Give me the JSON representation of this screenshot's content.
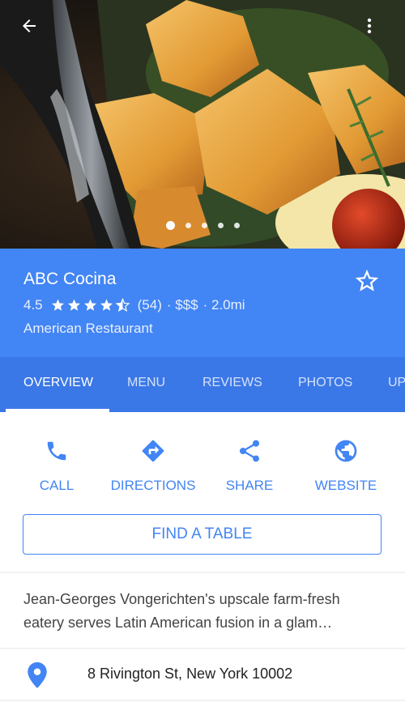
{
  "place": {
    "name": "ABC Cocina",
    "rating": "4.5",
    "review_count": "(54)",
    "price": "· $$$",
    "distance": "· 2.0mi",
    "category": "American Restaurant"
  },
  "tabs": [
    "OVERVIEW",
    "MENU",
    "REVIEWS",
    "PHOTOS",
    "UP"
  ],
  "actions": {
    "call": "CALL",
    "directions": "DIRECTIONS",
    "share": "SHARE",
    "website": "WEBSITE"
  },
  "find_table": "FIND A TABLE",
  "description": "Jean-Georges Vongerichten's upscale farm-fresh eatery serves Latin American fusion in a glam…",
  "address": "8 Rivington St, New York 10002",
  "photo_carousel": {
    "photo_count": 5,
    "active_index": 0
  },
  "colors": {
    "brand_blue": "#4285f4",
    "tab_bar": "#3b78e7"
  },
  "icons": [
    "back-arrow-icon",
    "more-vert-icon",
    "star-outline-icon",
    "phone-icon",
    "directions-icon",
    "share-icon",
    "globe-icon",
    "location-pin-icon"
  ]
}
